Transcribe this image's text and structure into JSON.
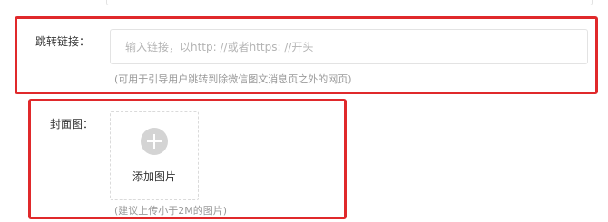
{
  "link_field": {
    "label": "跳转链接：",
    "placeholder": "输入链接，以http: //或者https: //开头",
    "value": "",
    "hint": "(可用于引导用户跳转到除微信图文消息页之外的网页)"
  },
  "cover_field": {
    "label": "封面图：",
    "upload_label": "添加图片",
    "hint": "(建议上传小于2M的图片)"
  },
  "colors": {
    "highlight_border": "#e0292b",
    "hint_text": "#9a9a9a",
    "placeholder_text": "#b4b4b4",
    "plus_circle": "#d4d4d4"
  },
  "icons": {
    "upload": "plus-icon"
  }
}
